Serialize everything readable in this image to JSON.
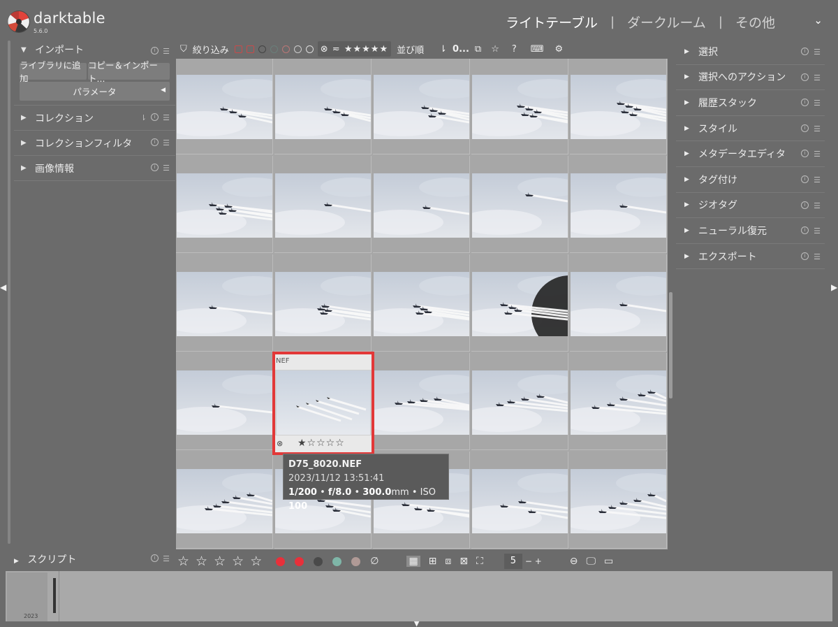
{
  "app": {
    "name": "darktable",
    "version": "5.6.0"
  },
  "views": {
    "lighttable": "ライトテーブル",
    "darkroom": "ダークルーム",
    "other": "その他"
  },
  "left_panel": {
    "import": {
      "title": "インポート",
      "add_to_library": "ライブラリに追加",
      "copy_import": "コピー＆インポート...",
      "parameters": "パラメータ"
    },
    "collections": "コレクション",
    "collection_filters": "コレクションフィルタ",
    "image_info": "画像情報",
    "scripts": "スクリプト"
  },
  "toolbar": {
    "filter_label": "絞り込み",
    "sort_label": "並び順",
    "sort_value": "0..."
  },
  "grid": {
    "columns": 5,
    "rows_visible": 5,
    "selected_index": 16
  },
  "selected_thumb": {
    "ext": "NEF",
    "rating": 1,
    "stars": "★☆☆☆☆"
  },
  "tooltip": {
    "filename": "D75_8020.NEF",
    "datetime": "2023/11/12 13:51:41",
    "shutter": "1/200",
    "aperture": "f/8.0",
    "focal": "300.0",
    "focal_unit": "mm",
    "iso_label": "ISO",
    "iso": "100"
  },
  "right_panel": [
    "選択",
    "選択へのアクション",
    "履歴スタック",
    "スタイル",
    "メタデータエディタ",
    "タグ付け",
    "ジオタグ",
    "ニューラル復元",
    "エクスポート"
  ],
  "bottom": {
    "zoom": "5",
    "filmstrip_year": "2023"
  },
  "colors": {
    "selection": "#e23838",
    "panel_bg": "#6b6b6b",
    "grid_bg": "#a7a7a7",
    "red_label": "#e8303a",
    "green_label": "#7fb6a8",
    "purple_label": "#b09a96"
  }
}
